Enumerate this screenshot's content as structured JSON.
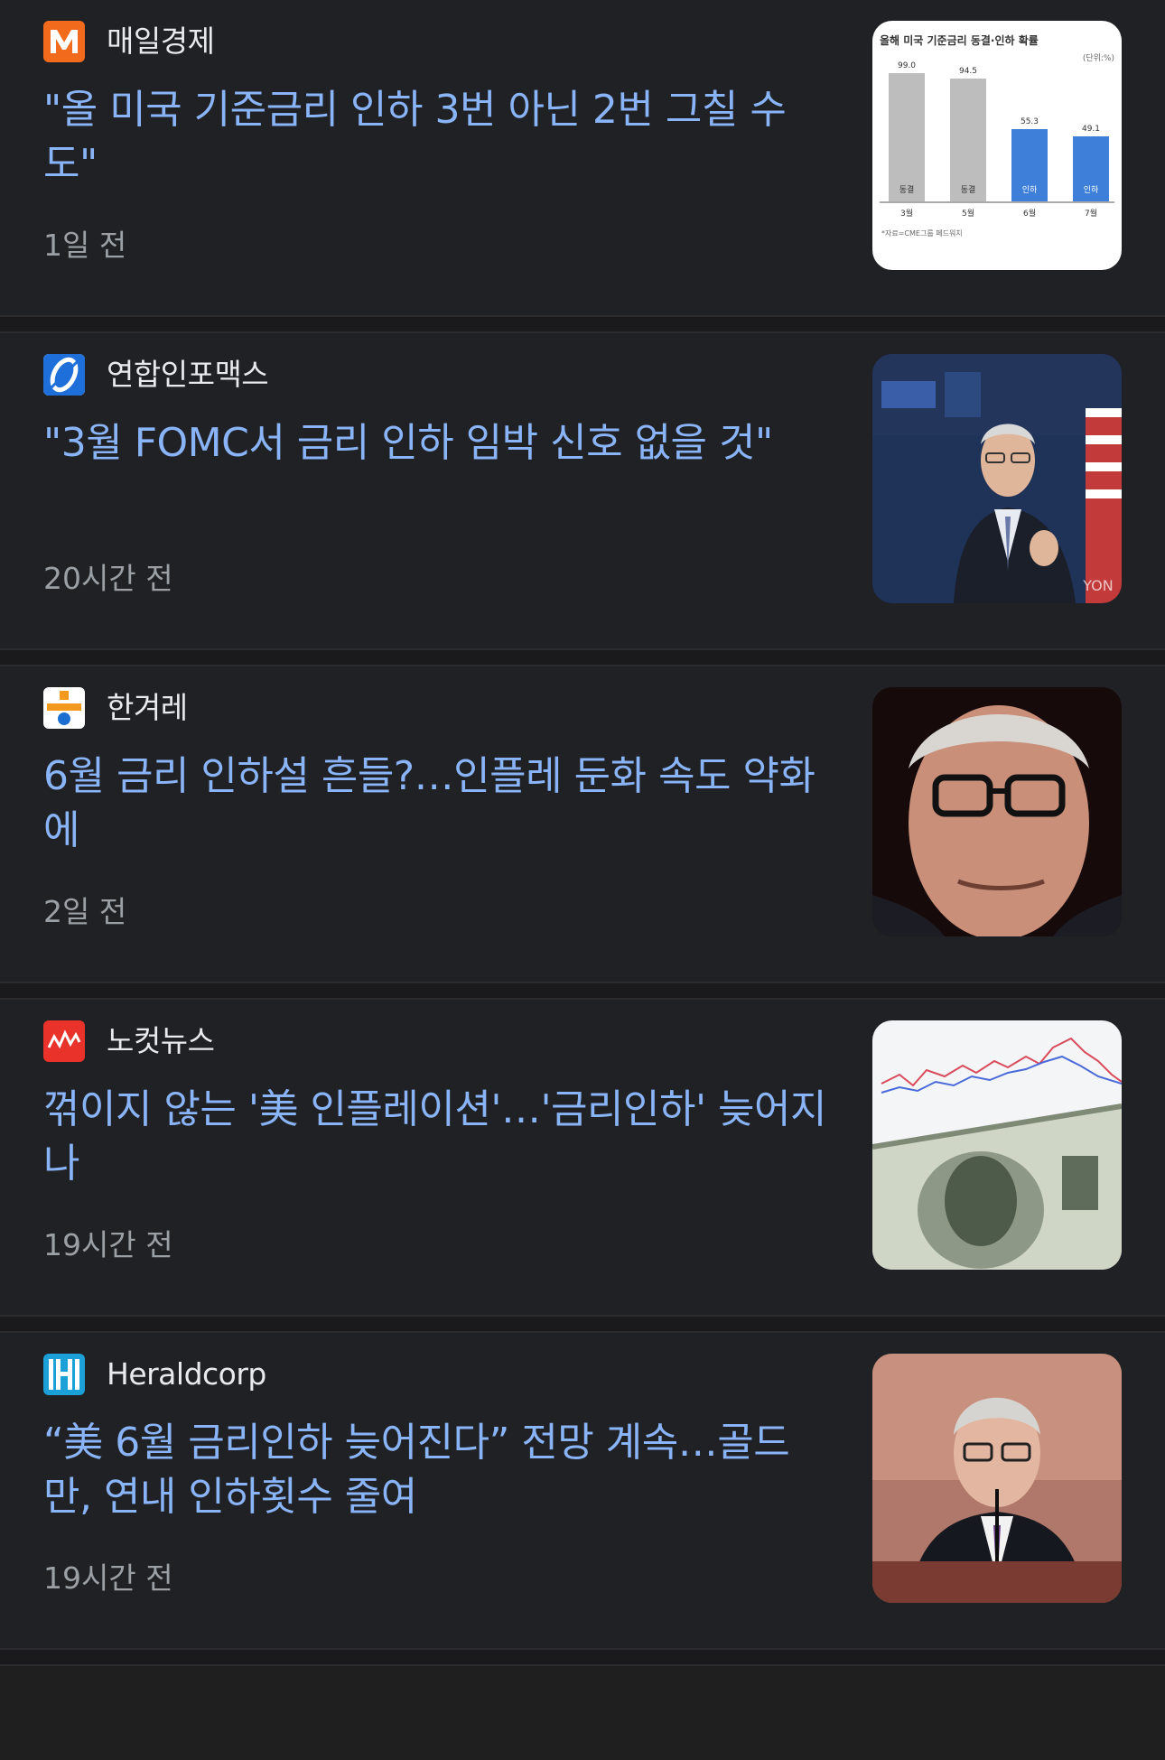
{
  "articles": [
    {
      "source": "매일경제",
      "headline": "\"올 미국 기준금리 인하 3번 아닌 2번 그칠 수도\"",
      "time": "1일 전",
      "thumb": {
        "chart_title": "올해 미국 기준금리 동결·인하 확률",
        "chart_unit": "(단위:%)",
        "bars": [
          {
            "value": "99.0",
            "state": "동결",
            "month": "3월"
          },
          {
            "value": "94.5",
            "state": "동결",
            "month": "5월"
          },
          {
            "value": "55.3",
            "state": "인하",
            "month": "6월"
          },
          {
            "value": "49.1",
            "state": "인하",
            "month": "7월"
          }
        ],
        "chart_source": "*자료=CME그룹 페드워치"
      }
    },
    {
      "source": "연합인포맥스",
      "headline": "\"3월 FOMC서 금리 인하 임박 신호 없을 것\"",
      "time": "20시간 전",
      "thumb": {
        "watermark": "YON"
      }
    },
    {
      "source": "한겨레",
      "headline": "6월 금리 인하설 흔들?…인플레 둔화 속도 약화에",
      "time": "2일 전"
    },
    {
      "source": "노컷뉴스",
      "headline": "꺾이지 않는 '美 인플레이션'…'금리인하' 늦어지나",
      "time": "19시간 전"
    },
    {
      "source": "Heraldcorp",
      "headline": "“美 6월 금리인하 늦어진다” 전망 계속…골드만, 연내 인하횟수 줄여",
      "time": "19시간 전"
    }
  ],
  "colors": {
    "background": "#202124",
    "headline": "#8ab4f8",
    "source_text": "#e8eaed",
    "time_text": "#9aa0a6",
    "maeil_logo": "#f26b1d",
    "nocut_logo": "#e8322a",
    "herald_logo": "#1ba0d8"
  },
  "icons": [
    "maeil-logo-icon",
    "yonhap-infomax-logo-icon",
    "hankyoreh-logo-icon",
    "nocut-logo-icon",
    "heraldcorp-logo-icon"
  ]
}
